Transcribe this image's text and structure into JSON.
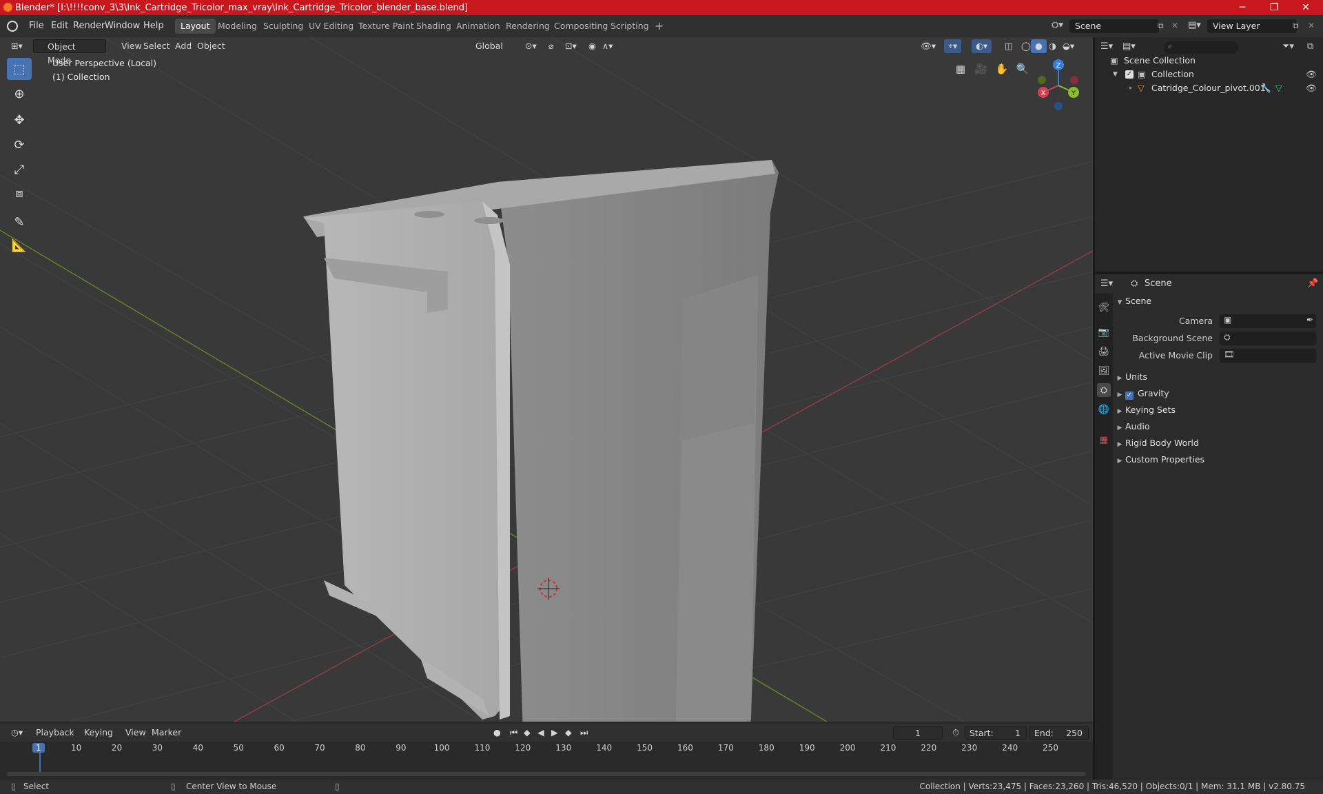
{
  "window": {
    "title": "Blender* [I:\\!!!!conv_3\\3\\Ink_Cartridge_Tricolor_max_vray\\Ink_Cartridge_Tricolor_blender_base.blend]",
    "minimize": "─",
    "maximize": "❐",
    "close": "✕"
  },
  "menu": [
    "File",
    "Edit",
    "Render",
    "Window",
    "Help"
  ],
  "workspaces": [
    "Layout",
    "Modeling",
    "Sculpting",
    "UV Editing",
    "Texture Paint",
    "Shading",
    "Animation",
    "Rendering",
    "Compositing",
    "Scripting"
  ],
  "workspace_add": "+",
  "scene_field": "Scene",
  "view_layer_field": "View Layer",
  "viewport": {
    "mode": "Object Mode",
    "menus": [
      "View",
      "Select",
      "Add",
      "Object"
    ],
    "transform_orientation": "Global",
    "perspective_label": "User Perspective (Local)",
    "collection_label": "(1) Collection",
    "gizmo": {
      "z": "Z",
      "x": "X",
      "y": "Y"
    }
  },
  "outliner": {
    "search_placeholder": "",
    "scene_collection": "Scene Collection",
    "collection": "Collection",
    "object": "Catridge_Colour_pivot.001"
  },
  "properties": {
    "header": "Scene",
    "panel": "Scene",
    "camera_label": "Camera",
    "background_scene_label": "Background Scene",
    "active_movie_clip_label": "Active Movie Clip",
    "subpanels": [
      "Units",
      "Gravity",
      "Keying Sets",
      "Audio",
      "Rigid Body World",
      "Custom Properties"
    ],
    "gravity_checked": true
  },
  "timeline": {
    "menus": [
      "Playback",
      "Keying",
      "View",
      "Marker"
    ],
    "current_frame": "1",
    "start_label": "Start:",
    "start": "1",
    "end_label": "End:",
    "end": "250",
    "ticks": [
      "1",
      "10",
      "20",
      "30",
      "40",
      "50",
      "60",
      "70",
      "80",
      "90",
      "100",
      "110",
      "120",
      "130",
      "140",
      "150",
      "160",
      "170",
      "180",
      "190",
      "200",
      "210",
      "220",
      "230",
      "240",
      "250"
    ]
  },
  "status": {
    "left": "Select",
    "middle": "Center View to Mouse",
    "right": "Collection | Verts:23,475 | Faces:23,260 | Tris:46,520 | Objects:0/1 | Mem: 31.1 MB | v2.80.75"
  },
  "colors": {
    "titlebar": "#c8181e",
    "accent": "#4772b3",
    "x_axis": "#d6404f",
    "y_axis": "#8bbd2a",
    "z_axis": "#3a7fd6"
  }
}
